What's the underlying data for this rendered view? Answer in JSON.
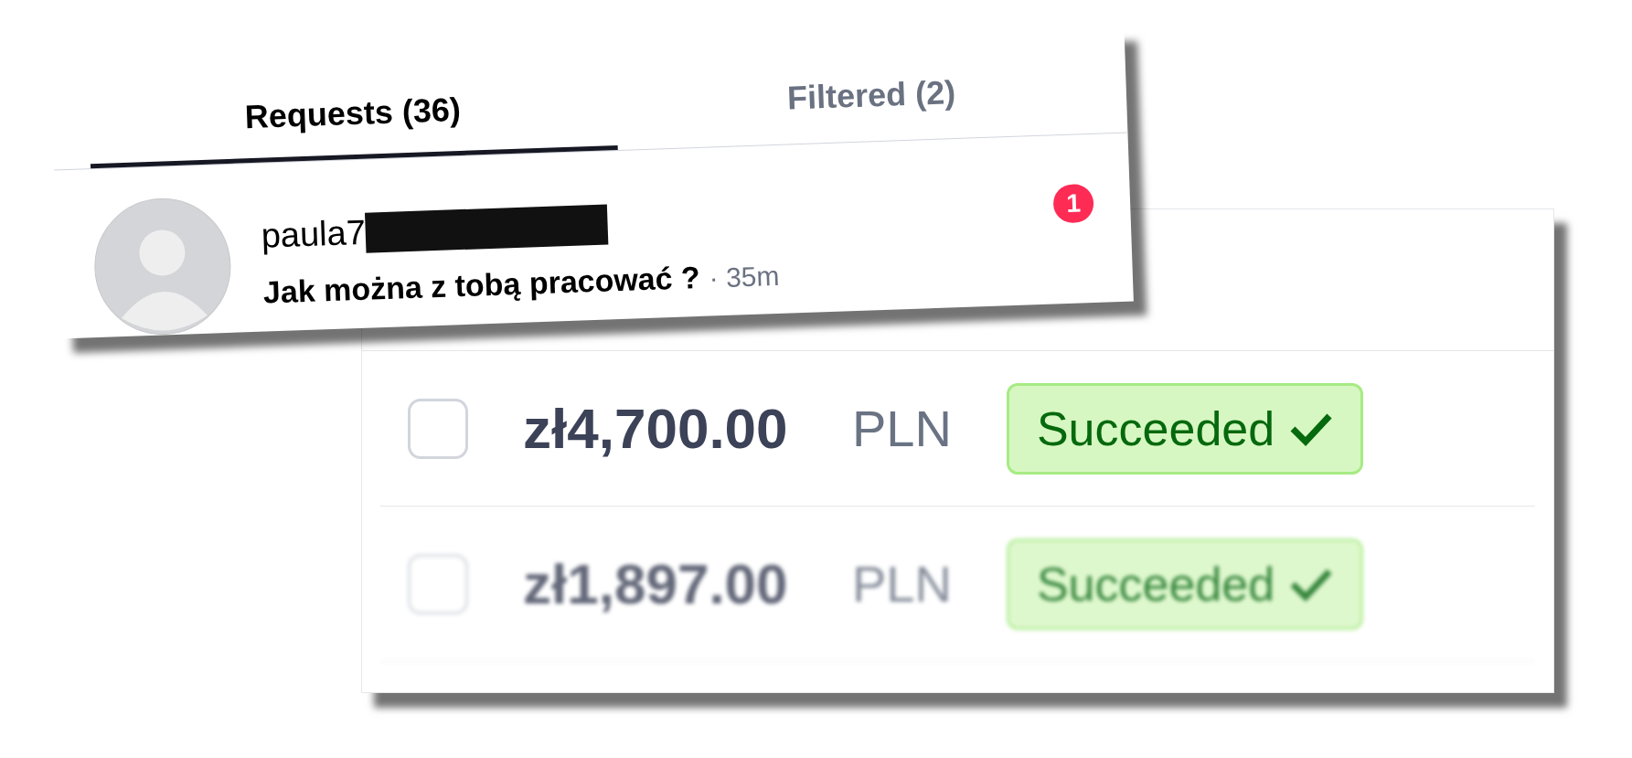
{
  "requests_panel": {
    "tabs": [
      {
        "label": "Requests (36)",
        "selected": true
      },
      {
        "label": "Filtered (2)",
        "selected": false
      }
    ],
    "requests": [
      {
        "username": "paula7",
        "redacted": true,
        "message": "Jak można z tobą pracować ?",
        "time": "· 35m",
        "unread_count": "1"
      }
    ]
  },
  "payments_table": {
    "rows": [
      {
        "checked": false,
        "amount": "zł4,700.00",
        "currency": "PLN",
        "status": "Succeeded",
        "blurred": false
      },
      {
        "checked": false,
        "amount": "zł1,897.00",
        "currency": "PLN",
        "status": "Succeeded",
        "blurred": true
      }
    ]
  }
}
